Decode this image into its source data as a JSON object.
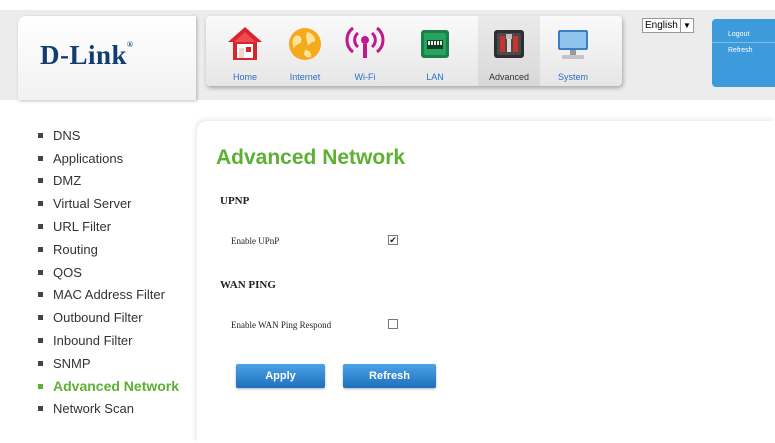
{
  "brand": {
    "logo_text": "D-Link",
    "registered": "®"
  },
  "nav": {
    "items": [
      {
        "label": "Home",
        "icon": "home-icon"
      },
      {
        "label": "Internet",
        "icon": "globe-icon"
      },
      {
        "label": "Wi-Fi",
        "icon": "wifi-icon"
      },
      {
        "label": "LAN",
        "icon": "lan-icon"
      },
      {
        "label": "Advanced",
        "icon": "tools-icon",
        "active": true
      },
      {
        "label": "System",
        "icon": "monitor-icon"
      }
    ]
  },
  "language": {
    "selected": "English"
  },
  "side_panel": {
    "logout": "Logout",
    "refresh": "Refresh"
  },
  "sidebar": {
    "items": [
      {
        "label": "DNS"
      },
      {
        "label": "Applications"
      },
      {
        "label": "DMZ"
      },
      {
        "label": "Virtual Server"
      },
      {
        "label": "URL Filter"
      },
      {
        "label": "Routing"
      },
      {
        "label": "QOS"
      },
      {
        "label": "MAC Address Filter"
      },
      {
        "label": "Outbound Filter"
      },
      {
        "label": "Inbound Filter"
      },
      {
        "label": "SNMP"
      },
      {
        "label": "Advanced Network",
        "active": true
      },
      {
        "label": "Network Scan"
      }
    ]
  },
  "main": {
    "title": "Advanced Network",
    "upnp": {
      "section": "UPNP",
      "label": "Enable UPnP",
      "checked": true
    },
    "wan_ping": {
      "section": "WAN PING",
      "label": "Enable WAN Ping Respond",
      "checked": false
    },
    "buttons": {
      "apply": "Apply",
      "refresh": "Refresh"
    }
  },
  "colors": {
    "accent_green": "#5cb032",
    "brand_blue": "#123d70",
    "button_blue": "#2a84d4"
  }
}
